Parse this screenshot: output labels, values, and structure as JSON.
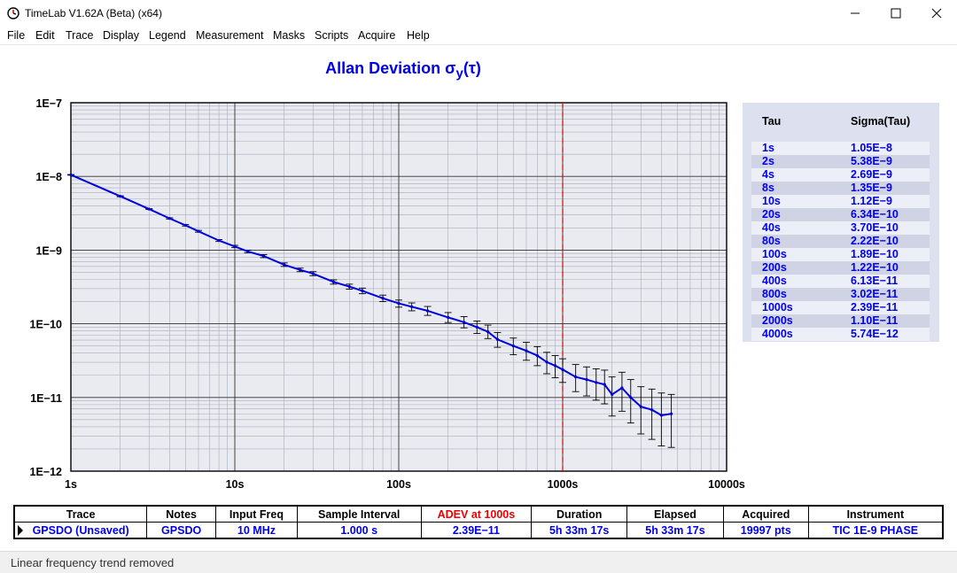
{
  "window": {
    "title": "TimeLab V1.62A (Beta) (x64)",
    "controls": [
      "minimize-icon",
      "maximize-icon",
      "close-icon"
    ]
  },
  "menu": [
    "File",
    "Edit",
    "Trace",
    "Display",
    "Legend",
    "Measurement",
    "Masks",
    "Scripts",
    "Acquire",
    "Help"
  ],
  "chart_title_main": "Allan Deviation σ",
  "chart_title_sub": "y",
  "chart_title_end": "(τ)",
  "chart_data": {
    "type": "line",
    "title": "Allan Deviation σy(τ)",
    "x_scale": "log",
    "y_scale": "log",
    "xlim": [
      1,
      10000
    ],
    "ylim": [
      1e-12,
      1e-07
    ],
    "x_ticks": [
      1,
      10,
      100,
      1000,
      10000
    ],
    "x_tick_labels": [
      "1s",
      "10s",
      "100s",
      "1000s",
      "10000s"
    ],
    "y_ticks": [
      1e-07,
      1e-08,
      1e-09,
      1e-10,
      1e-11,
      1e-12
    ],
    "y_tick_labels": [
      "1E−7",
      "1E−8",
      "1E−9",
      "1E−10",
      "1E−11",
      "1E−12"
    ],
    "grid": true,
    "marker_line": {
      "x": 1000,
      "color": "#e00000",
      "style": "dashed"
    },
    "series": [
      {
        "color": "#0000dd",
        "x": [
          1,
          2,
          3,
          4,
          5,
          6,
          8,
          10,
          12,
          15,
          20,
          25,
          30,
          40,
          50,
          60,
          80,
          100,
          120,
          150,
          200,
          250,
          300,
          350,
          400,
          500,
          600,
          700,
          800,
          900,
          1000,
          1200,
          1400,
          1600,
          1800,
          2000,
          2300,
          2600,
          3000,
          3500,
          4000,
          4600
        ],
        "y": [
          1.05e-08,
          5.38e-09,
          3.6e-09,
          2.69e-09,
          2.17e-09,
          1.8e-09,
          1.35e-09,
          1.12e-09,
          9.6e-10,
          8.3e-10,
          6.34e-10,
          5.4e-10,
          4.8e-10,
          3.7e-10,
          3.2e-10,
          2.8e-10,
          2.22e-10,
          1.89e-10,
          1.7e-10,
          1.5e-10,
          1.22e-10,
          1.05e-10,
          9e-11,
          7.8e-11,
          6.13e-11,
          5e-11,
          4.3e-11,
          3.7e-11,
          3.02e-11,
          2.7e-11,
          2.39e-11,
          1.9e-11,
          1.75e-11,
          1.6e-11,
          1.5e-11,
          1.1e-11,
          1.35e-11,
          1e-11,
          7.5e-12,
          6.8e-12,
          5.74e-12,
          6e-12
        ],
        "err_lo": [
          1.04e-08,
          5.3e-09,
          3.55e-09,
          2.64e-09,
          2.12e-09,
          1.75e-09,
          1.31e-09,
          1.08e-09,
          9.2e-10,
          7.9e-10,
          6e-10,
          5.1e-10,
          4.5e-10,
          3.45e-10,
          2.95e-10,
          2.56e-10,
          2e-10,
          1.68e-10,
          1.5e-10,
          1.3e-10,
          1.04e-10,
          8.8e-11,
          7.4e-11,
          6.3e-11,
          4.8e-11,
          3.8e-11,
          3.2e-11,
          2.7e-11,
          2.1e-11,
          1.85e-11,
          1.6e-11,
          1.2e-11,
          1.05e-11,
          9.2e-12,
          8.2e-12,
          5.6e-12,
          6.5e-12,
          4.5e-12,
          3.2e-12,
          2.7e-12,
          2.2e-12,
          2.1e-12
        ],
        "err_hi": [
          1.06e-08,
          5.46e-09,
          3.65e-09,
          2.74e-09,
          2.22e-09,
          1.85e-09,
          1.39e-09,
          1.16e-09,
          1e-09,
          8.7e-10,
          6.7e-10,
          5.7e-10,
          5.1e-10,
          3.95e-10,
          3.45e-10,
          3.05e-10,
          2.45e-10,
          2.1e-10,
          1.92e-10,
          1.72e-10,
          1.42e-10,
          1.25e-10,
          1.09e-10,
          9.6e-11,
          7.6e-11,
          6.4e-11,
          5.6e-11,
          4.9e-11,
          4.1e-11,
          3.7e-11,
          3.35e-11,
          2.8e-11,
          2.6e-11,
          2.45e-11,
          2.35e-11,
          1.9e-11,
          2.2e-11,
          1.75e-11,
          1.4e-11,
          1.3e-11,
          1.15e-11,
          1.1e-11
        ]
      }
    ]
  },
  "tau_table": {
    "headers": [
      "Tau",
      "Sigma(Tau)"
    ],
    "rows": [
      [
        "1s",
        "1.05E−8"
      ],
      [
        "2s",
        "5.38E−9"
      ],
      [
        "4s",
        "2.69E−9"
      ],
      [
        "8s",
        "1.35E−9"
      ],
      [
        "10s",
        "1.12E−9"
      ],
      [
        "20s",
        "6.34E−10"
      ],
      [
        "40s",
        "3.70E−10"
      ],
      [
        "80s",
        "2.22E−10"
      ],
      [
        "100s",
        "1.89E−10"
      ],
      [
        "200s",
        "1.22E−10"
      ],
      [
        "400s",
        "6.13E−11"
      ],
      [
        "800s",
        "3.02E−11"
      ],
      [
        "1000s",
        "2.39E−11"
      ],
      [
        "2000s",
        "1.10E−11"
      ],
      [
        "4000s",
        "5.74E−12"
      ]
    ]
  },
  "trace_table": {
    "headers": [
      "Trace",
      "Notes",
      "Input Freq",
      "Sample Interval",
      "ADEV at 1000s",
      "Duration",
      "Elapsed",
      "Acquired",
      "Instrument"
    ],
    "row": [
      "GPSDO (Unsaved)",
      "GPSDO",
      "10 MHz",
      "1.000 s",
      "2.39E−11",
      "5h 33m 17s",
      "5h 33m 17s",
      "19997 pts",
      "TIC 1E-9 PHASE"
    ],
    "highlight_color": "#ee0000"
  },
  "status": "Linear frequency trend removed"
}
